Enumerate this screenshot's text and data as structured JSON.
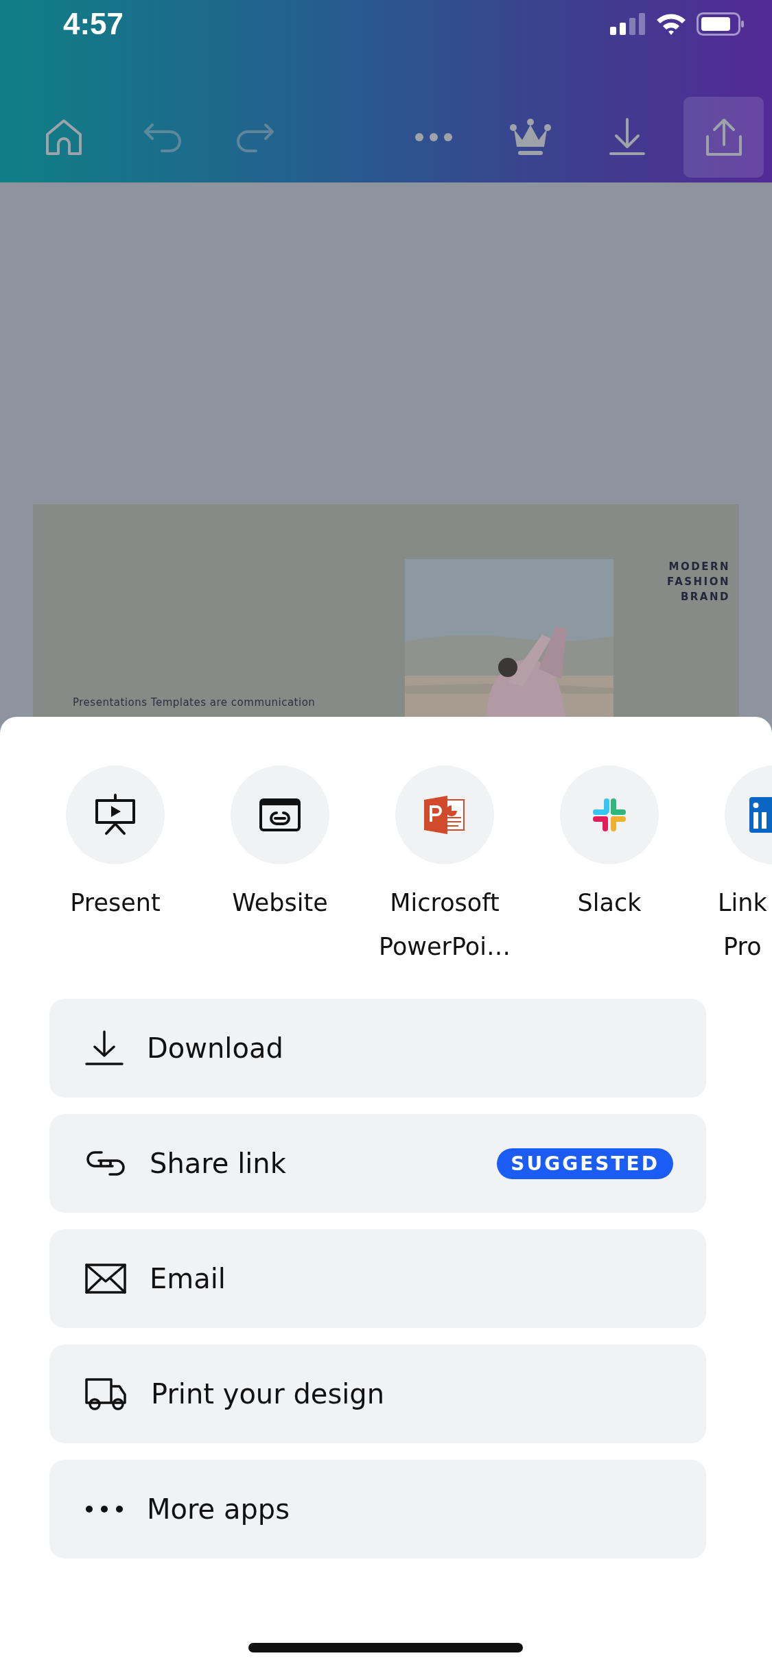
{
  "status_bar": {
    "time": "4:57"
  },
  "toolbar": {
    "items": [
      {
        "kind": "home",
        "disabled": false,
        "selected": false
      },
      {
        "kind": "undo",
        "disabled": true,
        "selected": false
      },
      {
        "kind": "redo",
        "disabled": true,
        "selected": false
      },
      {
        "kind": "more",
        "disabled": false,
        "selected": false
      },
      {
        "kind": "crown",
        "disabled": false,
        "selected": false
      },
      {
        "kind": "download",
        "disabled": false,
        "selected": false
      },
      {
        "kind": "share",
        "disabled": false,
        "selected": true
      }
    ]
  },
  "slide": {
    "title": "MODERN FASHION BRAND",
    "body": "Presentations Templates are communication"
  },
  "share_sheet": {
    "apps": [
      {
        "kind": "present",
        "label": "Present"
      },
      {
        "kind": "website",
        "label": "Website"
      },
      {
        "kind": "powerpoint",
        "label": "Microsoft PowerPoi…"
      },
      {
        "kind": "slack",
        "label": "Slack"
      },
      {
        "kind": "linkedin",
        "label": "Link Pro"
      }
    ],
    "actions": [
      {
        "kind": "download",
        "label": "Download"
      },
      {
        "kind": "link",
        "label": "Share link",
        "badge": "SUGGESTED"
      },
      {
        "kind": "email",
        "label": "Email"
      },
      {
        "kind": "print",
        "label": "Print your design"
      },
      {
        "kind": "more",
        "label": "More apps"
      }
    ]
  }
}
